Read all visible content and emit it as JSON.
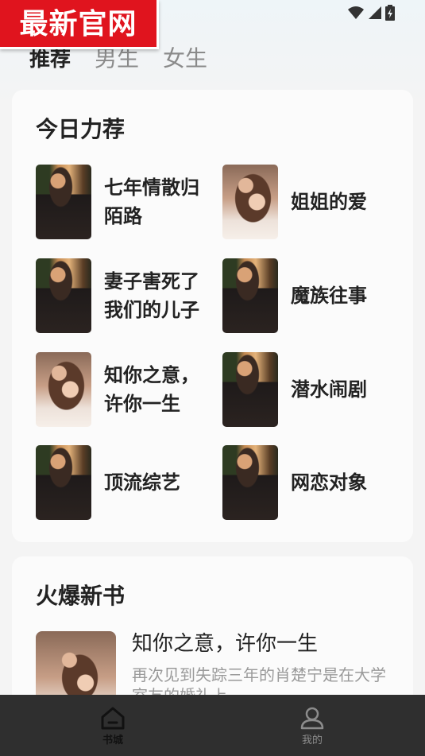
{
  "badge": {
    "text": "最新官网"
  },
  "tabs": [
    {
      "label": "推荐",
      "active": true
    },
    {
      "label": "男生",
      "active": false
    },
    {
      "label": "女生",
      "active": false
    }
  ],
  "today_picks": {
    "title": "今日力荐",
    "books": [
      {
        "title": "七年情散归陌路",
        "cover": "dark"
      },
      {
        "title": "姐姐的爱",
        "cover": "light"
      },
      {
        "title": "妻子害死了我们的儿子",
        "cover": "dark"
      },
      {
        "title": "魔族往事",
        "cover": "dark"
      },
      {
        "title": "知你之意，许你一生",
        "cover": "light"
      },
      {
        "title": "潜水闹剧",
        "cover": "dark"
      },
      {
        "title": "顶流综艺",
        "cover": "dark"
      },
      {
        "title": "网恋对象",
        "cover": "dark"
      }
    ]
  },
  "hot_new": {
    "title": "火爆新书",
    "featured": {
      "title": "知你之意，许你一生",
      "desc": "再次见到失踪三年的肖楚宁是在大学室友的婚礼上"
    }
  },
  "bottom_nav": {
    "home_label": "书城",
    "me_label": "我的"
  },
  "icons": {
    "wifi": "wifi-icon",
    "signal": "signal-icon",
    "battery": "battery-icon",
    "home": "home-icon",
    "user": "user-icon"
  },
  "colors": {
    "badge_red": "#e0141e",
    "nav_bg": "#2f2f2f",
    "text_dark": "#222222",
    "text_muted": "#8a8a8a"
  }
}
